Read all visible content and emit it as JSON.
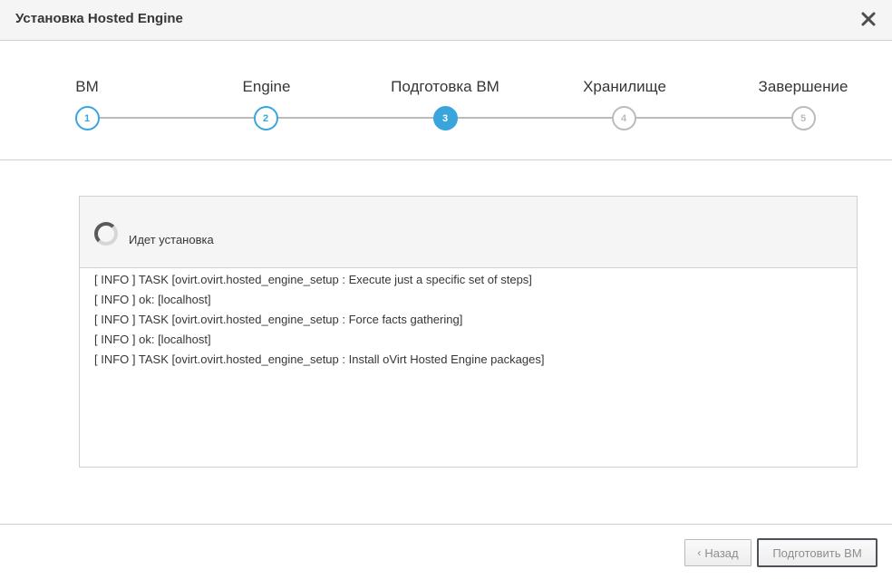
{
  "dialog": {
    "title": "Установка Hosted Engine",
    "close_icon": "close-icon"
  },
  "steps": [
    {
      "label": "ВМ",
      "number": "1",
      "state": "done"
    },
    {
      "label": "Engine",
      "number": "2",
      "state": "done"
    },
    {
      "label": "Подготовка ВМ",
      "number": "3",
      "state": "active"
    },
    {
      "label": "Хранилище",
      "number": "4",
      "state": "pending"
    },
    {
      "label": "Завершение",
      "number": "5",
      "state": "pending"
    }
  ],
  "log": {
    "status": "Идет установка",
    "spinner_icon": "spinner-icon",
    "lines": [
      "[ INFO ] TASK [ovirt.ovirt.hosted_engine_setup : Execute just a specific set of steps]",
      "[ INFO ] ok: [localhost]",
      "[ INFO ] TASK [ovirt.ovirt.hosted_engine_setup : Force facts gathering]",
      "[ INFO ] ok: [localhost]",
      "[ INFO ] TASK [ovirt.ovirt.hosted_engine_setup : Install oVirt Hosted Engine packages]"
    ]
  },
  "footer": {
    "back_chevron": "‹",
    "back_label": "Назад",
    "next_label": "Подготовить ВМ"
  },
  "colors": {
    "accent": "#39a5dc",
    "pending": "#bbbbbb"
  }
}
